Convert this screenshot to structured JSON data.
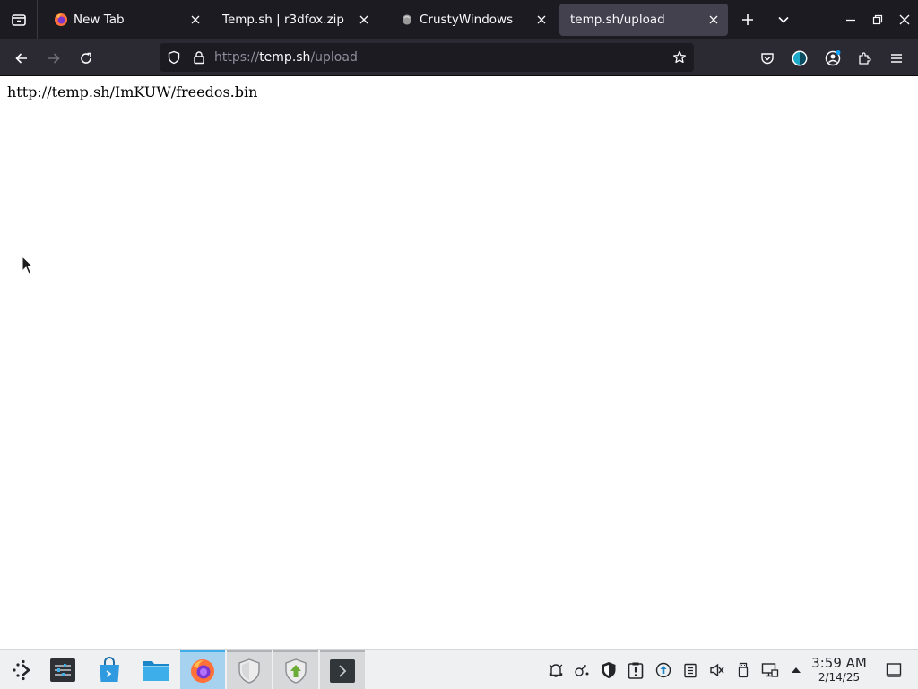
{
  "browser": {
    "tabs": [
      {
        "title": "New Tab",
        "icon": "firefox-icon",
        "active": false
      },
      {
        "title": "Temp.sh | r3dfox.zip",
        "icon": "",
        "active": false
      },
      {
        "title": "CrustyWindows",
        "icon": "crusty-windows-icon",
        "active": false
      },
      {
        "title": "temp.sh/upload",
        "icon": "",
        "active": true
      }
    ],
    "url": {
      "scheme": "https://",
      "host": "temp.sh",
      "path": "/upload"
    }
  },
  "page": {
    "text": "http://temp.sh/ImKUW/freedos.bin"
  },
  "taskbar": {
    "apps": [
      "application-launcher",
      "system-settings",
      "discover-store",
      "file-manager",
      "firefox",
      "shield-app",
      "update-app",
      "terminal"
    ],
    "clock": {
      "time": "3:59 AM",
      "date": "2/14/25"
    }
  },
  "colors": {
    "tabbar_bg": "#1c1b22",
    "navbar_bg": "#2b2a33",
    "active_tab_bg": "#42414d",
    "taskbar_bg": "#eff0f1",
    "taskbar_active": "#a6d1ef"
  }
}
